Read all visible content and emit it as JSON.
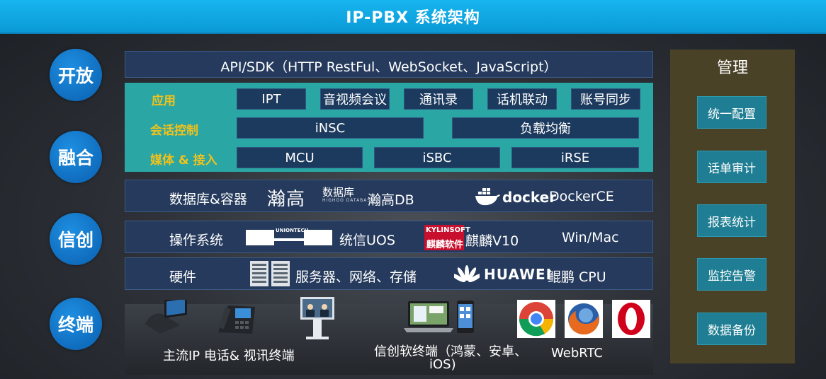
{
  "title": "IP-PBX 系统架构",
  "circles": {
    "open": "开放",
    "fusion": "融合",
    "xinchuang": "信创",
    "terminal": "终端"
  },
  "api_bar": "API/SDK（HTTP RestFul、WebSocket、JavaScript）",
  "fusion_block": {
    "app_label": "应用",
    "session_label": "会话控制",
    "media_label": "媒体 & 接入",
    "apps": [
      "IPT",
      "音视频会议",
      "通讯录",
      "话机联动",
      "账号同步"
    ],
    "session": [
      "iNSC",
      "负载均衡"
    ],
    "media": [
      "MCU",
      "iSBC",
      "iRSE"
    ]
  },
  "db_row": {
    "label": "数据库&容器",
    "hg_logo": "瀚高",
    "hg_cn": "数据库",
    "hg_en": "HIGHGO DATABASE",
    "hg_product": "瀚高DB",
    "docker_logo": "docker",
    "docker_product": "DockerCE"
  },
  "os_row": {
    "label": "操作系统",
    "uniontech_logo": "UNIONTECH",
    "uos": "统信UOS",
    "kylin_logo_en": "KYLINSOFT",
    "kylin_logo_cn": "麒麟软件",
    "kylin": "麒麟V10",
    "winmac": "Win/Mac"
  },
  "hw_row": {
    "label": "硬件",
    "servers": "服务器、网络、存储",
    "huawei_logo": "HUAWEI",
    "kunpeng": "鲲鹏 CPU"
  },
  "terminals": {
    "ip_phone": "主流IP 电话& 视讯终端",
    "soft_line1": "信创软终端（鸿蒙、安卓、",
    "soft_line2": "iOS)",
    "webrtc": "WebRTC"
  },
  "management": {
    "title": "管理",
    "items": [
      "统一配置",
      "话单审计",
      "报表统计",
      "监控告警",
      "数据备份"
    ]
  },
  "colors": {
    "title_bar": "#0fa8e6",
    "circle": "#0e6fc2",
    "panel": "#253a5c",
    "teal": "#2aa6a4",
    "teal_label": "#f2c21a",
    "mgmt_bg": "#4a4226",
    "mgmt_item": "#1f7e93"
  }
}
